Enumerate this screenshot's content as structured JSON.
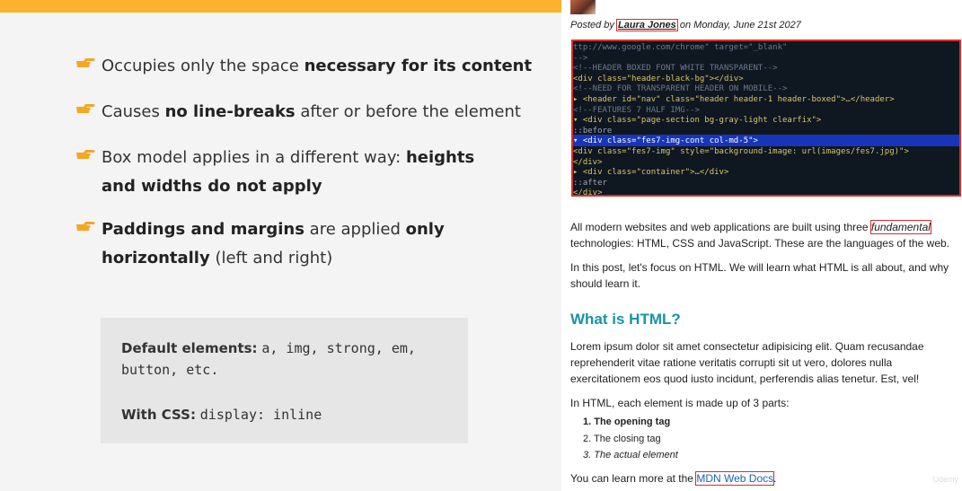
{
  "slide": {
    "bullets": [
      {
        "parts": [
          [
            "Occupies only the space ",
            false
          ],
          [
            "necessary for its content",
            true
          ]
        ]
      },
      {
        "parts": [
          [
            "Causes ",
            false
          ],
          [
            "no line-breaks",
            true
          ],
          [
            " after or before the element",
            false
          ]
        ]
      },
      {
        "parts": [
          [
            "Box model applies in a different way: ",
            false
          ],
          [
            "heights and widths do not apply",
            true
          ]
        ]
      },
      {
        "parts": [
          [
            "Paddings and margins",
            true
          ],
          [
            " are applied ",
            false
          ],
          [
            "only horizontally",
            true
          ],
          [
            " (left and right)",
            false
          ]
        ]
      }
    ],
    "box": {
      "default_label": "Default elements:",
      "default_value": "a, img, strong, em,",
      "default_value2": "button, etc.",
      "css_label": "With CSS:",
      "css_value": "display: inline"
    },
    "colors": {
      "accent": "#fbb22c",
      "hand": "#f5a623"
    }
  },
  "blog": {
    "posted_by": "Posted by",
    "author": "Laura Jones",
    "date_text": "on Monday, June 21st 2027",
    "code_lines": [
      {
        "text": "               ttp://www.google.com/chrome\" target=\"_blank\"",
        "color": "#6b7a8f"
      },
      {
        "text": "      -->",
        "color": "#6b7a8f"
      },
      {
        "text": "      <!--HEADER BOXED FONT WHITE TRANSPARENT-->",
        "color": "#6b7a8f"
      },
      {
        "text": "      <div class=\"header-black-bg\"></div>",
        "color": "#d8c56a"
      },
      {
        "text": "      <!--NEED FOR TRANSPARENT HEADER ON MOBILE-->",
        "color": "#6b7a8f"
      },
      {
        "text": "    ▸ <header id=\"nav\" class=\"header header-1 header-boxed\">…</header>",
        "color": "#d8c56a"
      },
      {
        "text": "      <!--FEATURES 7 HALF IMG-->",
        "color": "#6b7a8f"
      },
      {
        "text": "    ▾ <div class=\"page-section bg-gray-light clearfix\">",
        "color": "#d8c56a"
      },
      {
        "text": "        ::before",
        "color": "#9aa5b1"
      },
      {
        "text": "      ▾ <div class=\"fes7-img-cont col-md-5\">",
        "color": "#ffffff"
      },
      {
        "text": "          <div class=\"fes7-img\" style=\"background-image: url(images/fes7.jpg)\">",
        "color": "#d8c56a"
      },
      {
        "text": "        </div>",
        "color": "#d8c56a"
      },
      {
        "text": "      ▸ <div class=\"container\">…</div>",
        "color": "#d8c56a"
      },
      {
        "text": "        ::after",
        "color": "#9aa5b1"
      },
      {
        "text": "      </div>",
        "color": "#d8c56a"
      }
    ],
    "para1_before": "All modern websites and web applications are built using three ",
    "para1_em": "fundamental",
    "para1_after": " technologies: HTML, CSS and JavaScript. These are the languages of the web.",
    "para2": "In this post, let's focus on HTML. We will learn what HTML is all about, and why should learn it.",
    "heading": "What is HTML?",
    "para3": "Lorem ipsum dolor sit amet consectetur adipisicing elit. Quam recusandae reprehenderit vitae ratione veritatis corrupti sit ut vero, dolores nulla exercitationem eos quod iusto incidunt, perferendis alias tenetur. Est, vel!",
    "para4": "In HTML, each element is made up of 3 parts:",
    "list": [
      "1. The opening tag",
      "2. The closing tag",
      "3. The actual element"
    ],
    "para5_before": "You can learn more at the ",
    "link": "MDN Web Docs",
    "para5_after": ".",
    "watermark": "Udemy"
  }
}
